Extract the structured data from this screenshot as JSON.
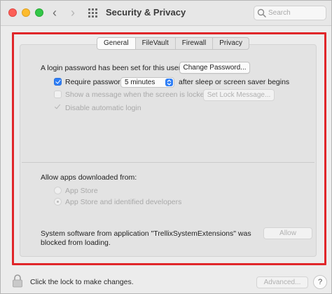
{
  "window": {
    "title": "Security & Privacy"
  },
  "search": {
    "placeholder": "Search"
  },
  "tabs": [
    {
      "label": "General",
      "active": true
    },
    {
      "label": "FileVault",
      "active": false
    },
    {
      "label": "Firewall",
      "active": false
    },
    {
      "label": "Privacy",
      "active": false
    }
  ],
  "general": {
    "login_password_text": "A login password has been set for this user",
    "change_password_label": "Change Password...",
    "require_password_label": "Require password",
    "require_password_checked": true,
    "require_password_delay": "5 minutes",
    "after_sleep_text": "after sleep or screen saver begins",
    "show_message_label": "Show a message when the screen is locked",
    "set_lock_message_label": "Set Lock Message...",
    "disable_auto_login_label": "Disable automatic login"
  },
  "allow_apps": {
    "heading": "Allow apps downloaded from:",
    "options": [
      "App Store",
      "App Store and identified developers"
    ],
    "selected": "App Store and identified developers"
  },
  "blocked": {
    "message_line1": "System software from application \"TrellixSystemExtensions\" was",
    "message_line2": "blocked from loading.",
    "allow_label": "Allow"
  },
  "footer": {
    "lock_text": "Click the lock to make changes.",
    "advanced_label": "Advanced...",
    "help_label": "?"
  },
  "colors": {
    "highlight": "#e0262a",
    "accent": "#2e7ef6"
  }
}
